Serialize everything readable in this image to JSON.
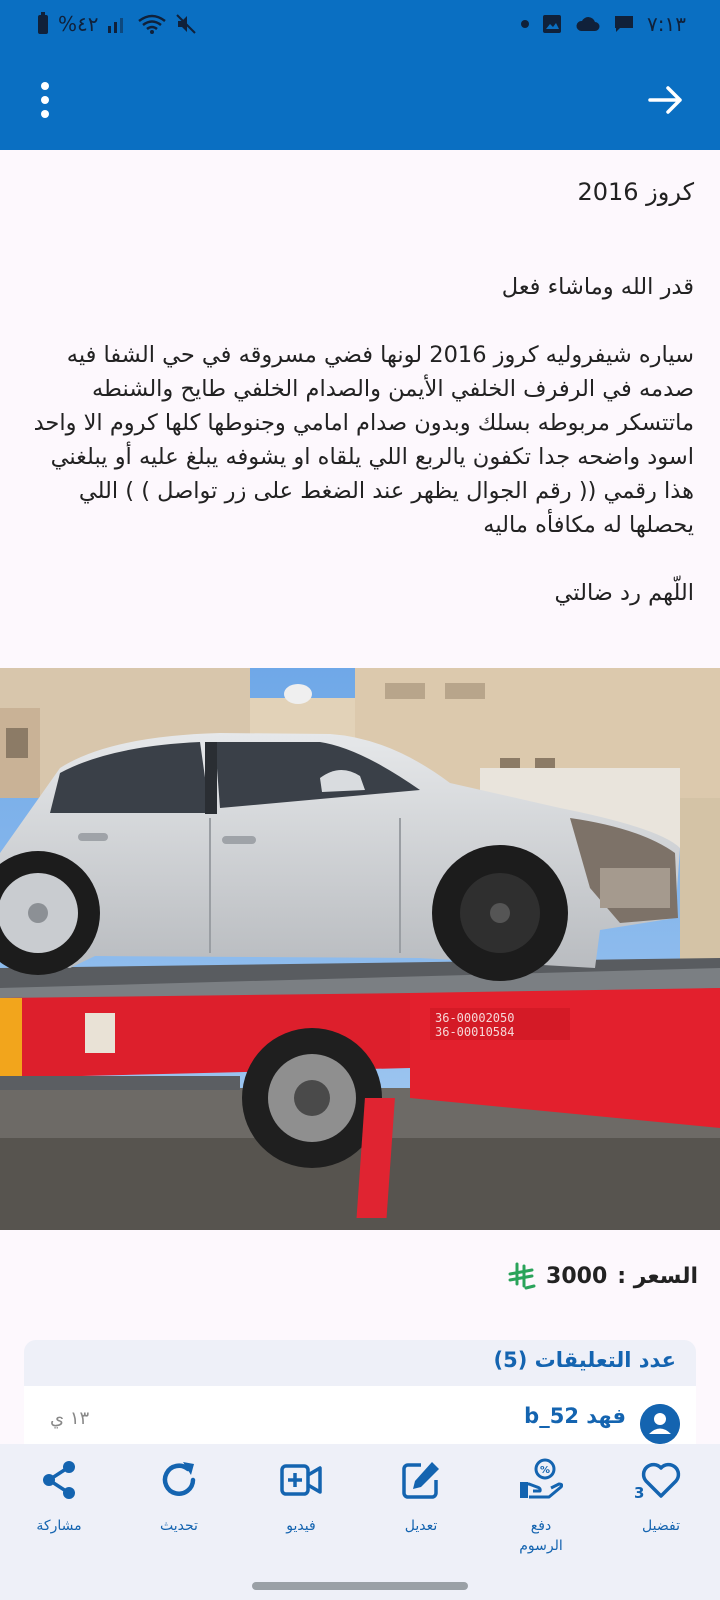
{
  "status_bar": {
    "battery": "%٤٢",
    "time": "٧:١٣"
  },
  "listing": {
    "title": "كروز 2016",
    "description": "قدر الله وماشاء فعل\n\nسياره شيفروليه كروز 2016 لونها فضي مسروقه في حي الشفا فيه صدمه في الرفرف الخلفي الأيمن والصدام الخلفي طايح والشنطه ماتتسكر مربوطه بسلك وبدون صدام امامي وجنوطها كلها كروم الا واحد اسود واضحه جدا تكفون يالربع اللي يلقاه او يشوفه يبلغ عليه أو يبلغني هذا رقمي (( رقم الجوال يظهر عند الضغط على زر تواصل ) ) اللي يحصلها له مكافأه ماليه\n\nاللّهم رد ضالتي",
    "price_label": "السعر :",
    "price_value": "3000",
    "currency_icon": "saudi-riyal-icon"
  },
  "comments": {
    "title": "عدد التعليقات (5)",
    "items": [
      {
        "user": "فهد b_52",
        "time": "١٣ ي"
      }
    ]
  },
  "bottom_nav": {
    "items": [
      {
        "label": "مشاركة",
        "icon": "share-icon"
      },
      {
        "label": "تحديث",
        "icon": "refresh-icon"
      },
      {
        "label": "فيديو",
        "icon": "video-icon"
      },
      {
        "label": "تعديل",
        "icon": "edit-icon"
      },
      {
        "label": "دفع الرسوم",
        "icon": "pay-fees-icon"
      },
      {
        "label": "تفضيل",
        "icon": "heart-icon",
        "count": "3"
      }
    ]
  },
  "colors": {
    "primary": "#0a6fc2",
    "accent": "#1464b0",
    "price_icon": "#2aa35a",
    "nav_bg": "#eef0f8"
  }
}
